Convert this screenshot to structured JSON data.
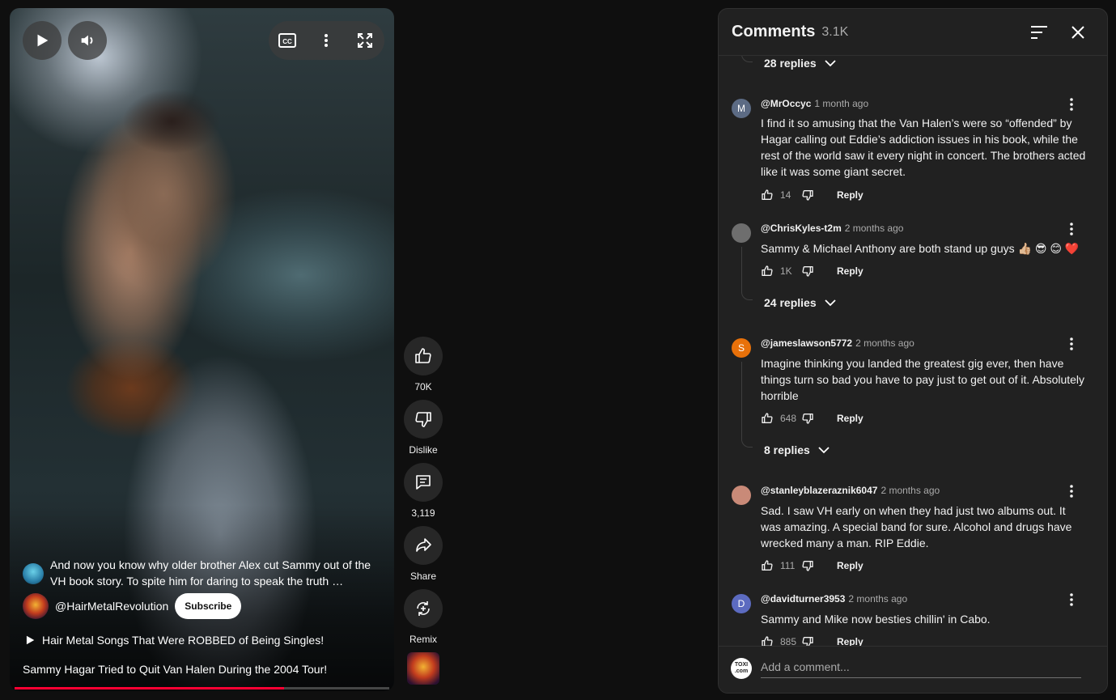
{
  "player": {
    "caption_text": "And now you know why older brother Alex cut Sammy out of the VH book story.  To spite him for daring to speak the truth …",
    "channel_name": "@HairMetalRevolution",
    "subscribe_label": "Subscribe",
    "playlist_title": "Hair Metal Songs That Were ROBBED of Being Singles!",
    "video_title": "Sammy Hagar Tried to Quit Van Halen During the 2004 Tour!",
    "progress": 0.72,
    "icons": {
      "play": "play-icon",
      "volume": "volume-icon",
      "cc": "cc-icon",
      "more": "more-vert-icon",
      "fullscreen": "fullscreen-icon"
    }
  },
  "actions": {
    "like_count": "70K",
    "dislike_label": "Dislike",
    "comments_count": "3,119",
    "share_label": "Share",
    "remix_label": "Remix"
  },
  "comments": {
    "title": "Comments",
    "count": "3.1K",
    "replies_top": "28 replies",
    "items": [
      {
        "author": "@MrOccyc",
        "time": "1 month ago",
        "avatar_letter": "M",
        "avatar_color": "#5c6b84",
        "text": "I find it so amusing that the Van Halen’s were so “offended” by Hagar calling out Eddie’s addiction issues in his book, while the rest of the world saw it every night in concert.  The brothers acted like it was some giant secret.",
        "likes": "14",
        "reply_label": "Reply"
      },
      {
        "author": "@ChrisKyles-t2m",
        "time": "2 months ago",
        "avatar_letter": "",
        "avatar_color": "#6e6e6e",
        "text": "Sammy & Michael Anthony are both stand up guys 👍🏼 😎 😊 ❤️",
        "likes": "1K",
        "reply_label": "Reply",
        "replies": "24 replies"
      },
      {
        "author": "@jameslawson5772",
        "time": "2 months ago",
        "avatar_letter": "S",
        "avatar_color": "#e8710a",
        "text": "Imagine thinking you landed the greatest gig ever, then have things turn so bad you have to pay just to get out of it. Absolutely horrible",
        "likes": "648",
        "reply_label": "Reply",
        "replies": "8 replies"
      },
      {
        "author": "@stanleyblazeraznik6047",
        "time": "2 months ago",
        "avatar_letter": "",
        "avatar_color": "#c98a78",
        "text": "Sad. I saw VH early on when they had just two albums out.  It was amazing. A special band for sure.  Alcohol and drugs have wrecked many a man.  RIP Eddie.",
        "likes": "111",
        "reply_label": "Reply"
      },
      {
        "author": "@davidturner3953",
        "time": "2 months ago",
        "avatar_letter": "D",
        "avatar_color": "#5c6bc0",
        "text": "Sammy and Mike now besties chillin' in Cabo.",
        "likes": "885",
        "reply_label": "Reply"
      }
    ],
    "footer_avatar_text": "TOXI .com",
    "add_placeholder": "Add a comment..."
  }
}
